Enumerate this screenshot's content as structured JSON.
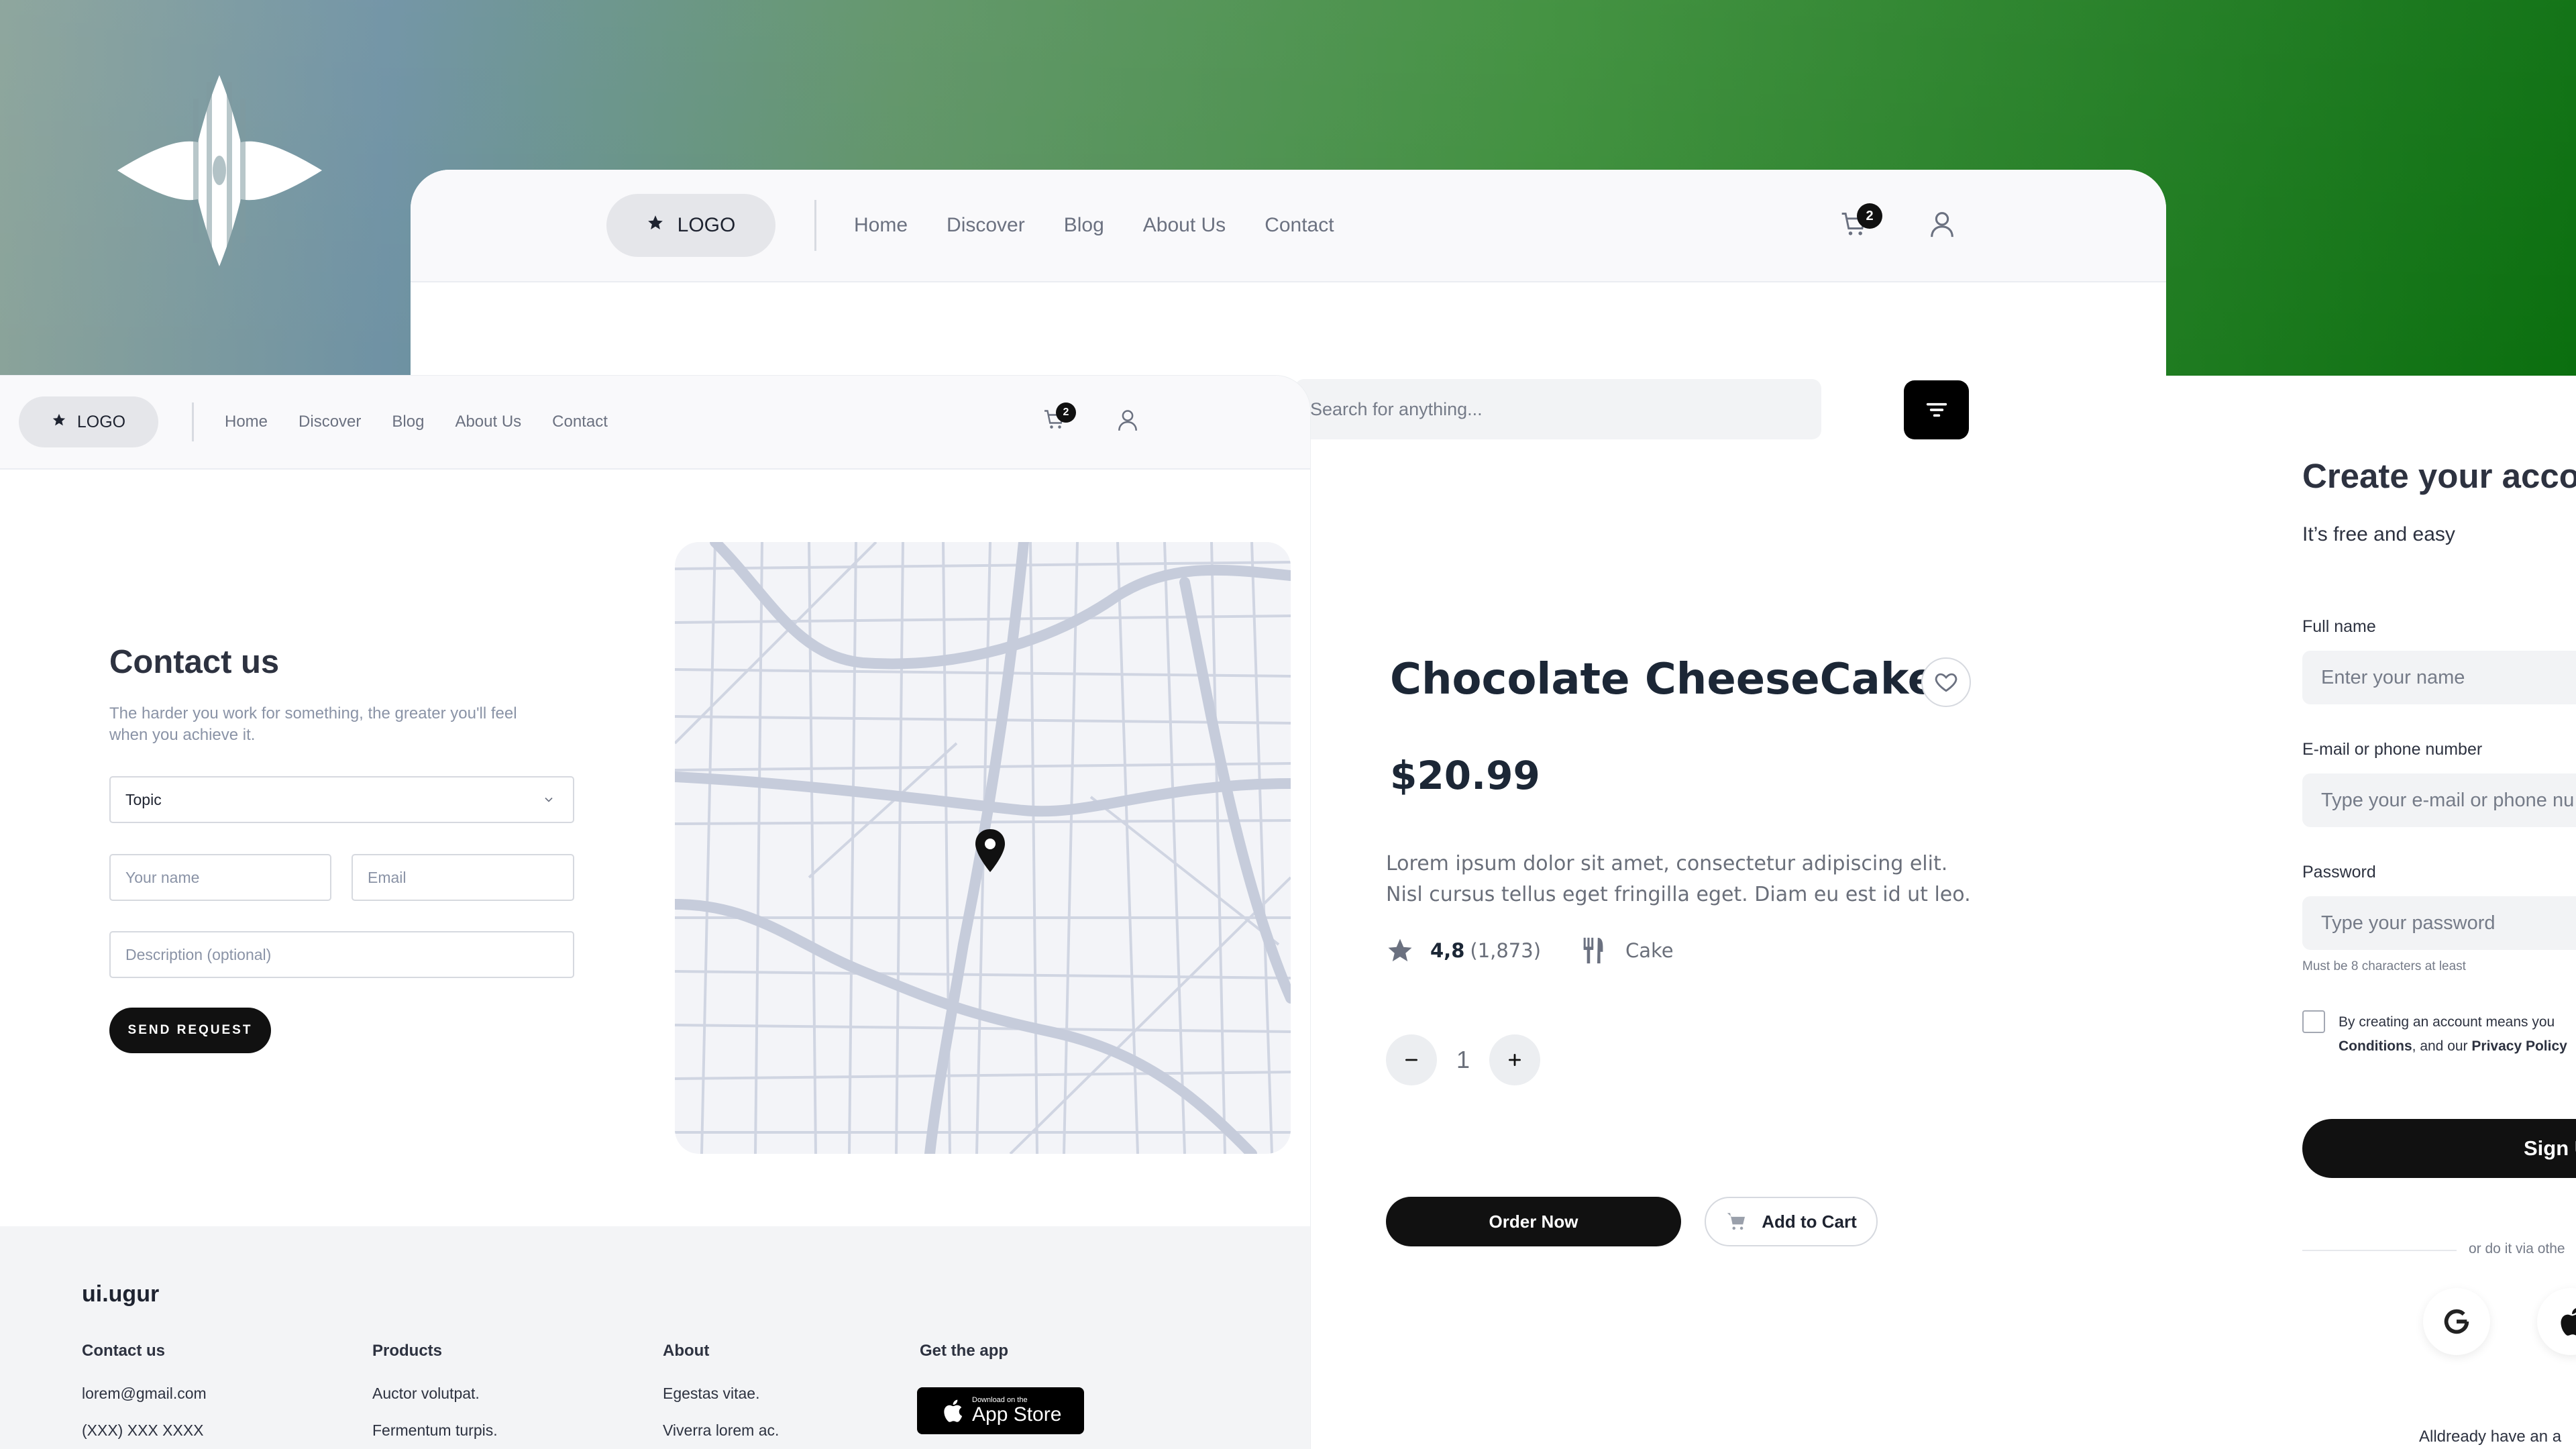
{
  "back_window": {
    "nav": {
      "logo": "LOGO",
      "links": [
        "Home",
        "Discover",
        "Blog",
        "About Us",
        "Contact"
      ],
      "cart_count": "2"
    },
    "search_placeholder": "Search for anything...",
    "product": {
      "title": "Chocolate CheeseCake",
      "price": "$20.99",
      "description": "Lorem ipsum dolor sit amet, consectetur adipiscing elit. Nisl cursus tellus eget fringilla eget. Diam eu est id ut leo.",
      "rating": "4,8",
      "rating_count": "(1,873)",
      "category": "Cake",
      "quantity": "1",
      "order_label": "Order Now",
      "cart_label": "Add to Cart"
    }
  },
  "front_window": {
    "nav": {
      "logo": "LOGO",
      "links": [
        "Home",
        "Discover",
        "Blog",
        "About Us",
        "Contact"
      ],
      "cart_count": "2"
    },
    "contact": {
      "title": "Contact us",
      "subtitle": "The harder you work for something, the greater you'll feel when you achieve it.",
      "topic": "Topic",
      "name_placeholder": "Your name",
      "email_placeholder": "Email",
      "description_placeholder": "Description (optional)",
      "send_label": "SEND REQUEST"
    },
    "footer": {
      "brand": "ui.ugur",
      "columns": [
        {
          "heading": "Contact us",
          "items": [
            "lorem@gmail.com",
            "(XXX) XXX XXXX"
          ]
        },
        {
          "heading": "Products",
          "items": [
            "Auctor volutpat.",
            "Fermentum turpis."
          ]
        },
        {
          "heading": "About",
          "items": [
            "Egestas vitae.",
            "Viverra lorem ac."
          ]
        },
        {
          "heading": "Get the app",
          "items": []
        }
      ],
      "appstore_small": "Download on the",
      "appstore_big": "App Store"
    }
  },
  "signup": {
    "title": "Create your acco",
    "subtitle": "It’s free and easy",
    "fullname_label": "Full name",
    "fullname_placeholder": "Enter your name",
    "email_label": "E-mail or phone number",
    "email_placeholder": "Type your e-mail or phone nu",
    "password_label": "Password",
    "password_placeholder": "Type your password",
    "password_hint": "Must be 8 characters at least",
    "terms_line1": "By creating an account means you",
    "terms_conditions": "Conditions",
    "terms_mid": ", and our ",
    "terms_privacy": "Privacy Policy",
    "button": "Sign U",
    "or_text": "or do it via othe",
    "already": "Alldready have an a"
  },
  "colors": {
    "accent_dark": "#111111",
    "gradient_start": "#8aa39a",
    "gradient_end": "#0b6f0f"
  },
  "icons": [
    "brand-mark-icon",
    "star-icon",
    "cart-icon",
    "user-icon",
    "filter-icon",
    "heart-icon",
    "fork-knife-icon",
    "minus-icon",
    "plus-icon",
    "chevron-down-icon",
    "map-pin-icon",
    "apple-icon",
    "google-icon"
  ]
}
